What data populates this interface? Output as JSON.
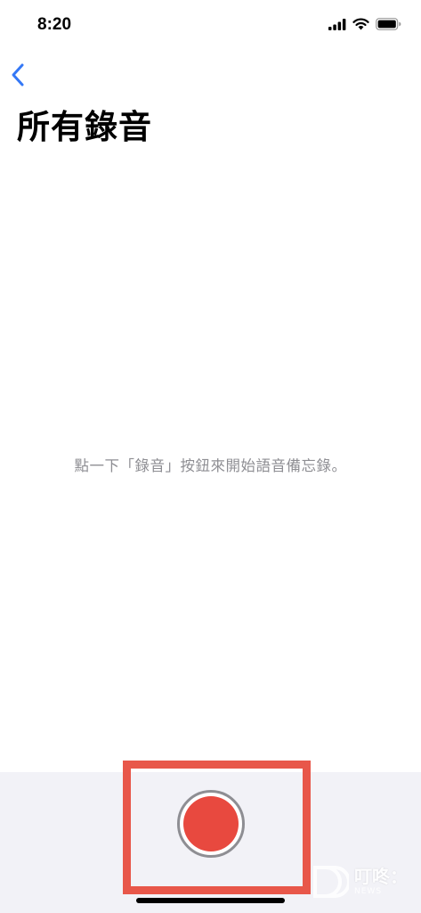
{
  "status_bar": {
    "time": "8:20",
    "icons": [
      "cellular-signal-icon",
      "wifi-icon",
      "battery-icon"
    ]
  },
  "nav": {
    "back_icon": "chevron-left-icon",
    "title": "所有錄音"
  },
  "main": {
    "empty_message": "點一下「錄音」按鈕來開始語音備忘錄。"
  },
  "bottom_bar": {
    "record_button_icon": "record-icon"
  },
  "watermark": {
    "name": "叮咚：",
    "sub": "NEWS"
  },
  "colors": {
    "accent": "#3478f6",
    "record": "#e8493f",
    "highlight": "#e8574a",
    "muted_text": "#8e8e93",
    "bottom_bar_bg": "#f2f2f7"
  }
}
